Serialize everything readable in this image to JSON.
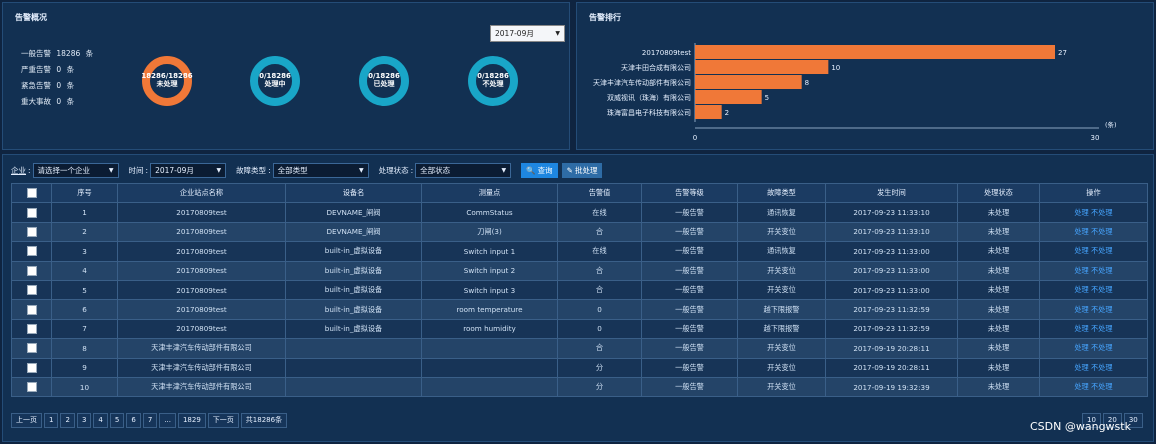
{
  "summary": {
    "title": "告警概况",
    "month": "2017-09月",
    "stats": [
      {
        "label": "一般告警",
        "value": "18286",
        "unit": "条"
      },
      {
        "label": "严重告警",
        "value": "0",
        "unit": "条"
      },
      {
        "label": "紧急告警",
        "value": "0",
        "unit": "条"
      },
      {
        "label": "重大事故",
        "value": "0",
        "unit": "条"
      }
    ],
    "donuts": [
      {
        "ratio": "18286/18286",
        "label": "未处理",
        "fraction": 1.0,
        "color": "#f07838"
      },
      {
        "ratio": "0/18286",
        "label": "处理中",
        "fraction": 1.0,
        "color": "#19a6c8"
      },
      {
        "ratio": "0/18286",
        "label": "已处理",
        "fraction": 1.0,
        "color": "#19a6c8"
      },
      {
        "ratio": "0/18286",
        "label": "不处理",
        "fraction": 1.0,
        "color": "#19a6c8"
      }
    ]
  },
  "ranking": {
    "title": "告警排行",
    "unit": "(条)",
    "chart_data": {
      "type": "bar",
      "orientation": "horizontal",
      "categories": [
        "20170809test",
        "天津丰田合成有限公司",
        "天津丰津汽车传动部件有限公司",
        "双威视讯（珠海）有限公司",
        "珠海富昌电子科技有限公司"
      ],
      "values": [
        27,
        10,
        8,
        5,
        2
      ],
      "xlim": [
        0,
        30
      ],
      "xticks": [
        "0",
        "30"
      ],
      "bar_color": "#f07838"
    }
  },
  "filters": {
    "enterprise_label": "企业",
    "enterprise_value": "请选择一个企业",
    "time_label": "时间",
    "time_value": "2017-09月",
    "fault_label": "故障类型",
    "fault_value": "全部类型",
    "status_label": "处理状态",
    "status_value": "全部状态",
    "query_label": "查询",
    "batch_label": "批处理"
  },
  "table": {
    "headers": [
      "序号",
      "企业站点名称",
      "设备名",
      "测量点",
      "告警值",
      "告警等级",
      "故障类型",
      "发生时间",
      "处理状态",
      "操作"
    ],
    "rows": [
      {
        "no": "1",
        "site": "20170809test",
        "device": "DEVNAME_闸阀",
        "point": "CommStatus",
        "value": "在线",
        "level": "一般告警",
        "fault": "通讯恢复",
        "time": "2017-09-23 11:33:10",
        "status": "未处理",
        "op1": "处理",
        "op2": "不处理"
      },
      {
        "no": "2",
        "site": "20170809test",
        "device": "DEVNAME_闸阀",
        "point": "刀闸(3)",
        "value": "合",
        "level": "一般告警",
        "fault": "开关变位",
        "time": "2017-09-23 11:33:10",
        "status": "未处理",
        "op1": "处理",
        "op2": "不处理"
      },
      {
        "no": "3",
        "site": "20170809test",
        "device": "built-in_虚拟设备",
        "point": "Switch input 1",
        "value": "在线",
        "level": "一般告警",
        "fault": "通讯恢复",
        "time": "2017-09-23 11:33:00",
        "status": "未处理",
        "op1": "处理",
        "op2": "不处理"
      },
      {
        "no": "4",
        "site": "20170809test",
        "device": "built-in_虚拟设备",
        "point": "Switch input 2",
        "value": "合",
        "level": "一般告警",
        "fault": "开关变位",
        "time": "2017-09-23 11:33:00",
        "status": "未处理",
        "op1": "处理",
        "op2": "不处理"
      },
      {
        "no": "5",
        "site": "20170809test",
        "device": "built-in_虚拟设备",
        "point": "Switch input 3",
        "value": "合",
        "level": "一般告警",
        "fault": "开关变位",
        "time": "2017-09-23 11:33:00",
        "status": "未处理",
        "op1": "处理",
        "op2": "不处理"
      },
      {
        "no": "6",
        "site": "20170809test",
        "device": "built-in_虚拟设备",
        "point": "room temperature",
        "value": "0",
        "level": "一般告警",
        "fault": "越下限报警",
        "time": "2017-09-23 11:32:59",
        "status": "未处理",
        "op1": "处理",
        "op2": "不处理"
      },
      {
        "no": "7",
        "site": "20170809test",
        "device": "built-in_虚拟设备",
        "point": "room humidity",
        "value": "0",
        "level": "一般告警",
        "fault": "越下限报警",
        "time": "2017-09-23 11:32:59",
        "status": "未处理",
        "op1": "处理",
        "op2": "不处理"
      },
      {
        "no": "8",
        "site": "天津丰津汽车传动部件有限公司",
        "device": "",
        "point": "",
        "value": "合",
        "level": "一般告警",
        "fault": "开关变位",
        "time": "2017-09-19 20:28:11",
        "status": "未处理",
        "op1": "处理",
        "op2": "不处理"
      },
      {
        "no": "9",
        "site": "天津丰津汽车传动部件有限公司",
        "device": "",
        "point": "",
        "value": "分",
        "level": "一般告警",
        "fault": "开关变位",
        "time": "2017-09-19 20:28:11",
        "status": "未处理",
        "op1": "处理",
        "op2": "不处理"
      },
      {
        "no": "10",
        "site": "天津丰津汽车传动部件有限公司",
        "device": "",
        "point": "",
        "value": "分",
        "level": "一般告警",
        "fault": "开关变位",
        "time": "2017-09-19 19:32:39",
        "status": "未处理",
        "op1": "处理",
        "op2": "不处理"
      }
    ]
  },
  "pager": {
    "prev": "上一页",
    "pages": [
      "1",
      "2",
      "3",
      "4",
      "5",
      "6",
      "7",
      "...",
      "1829"
    ],
    "next": "下一页",
    "total": "共18286条",
    "sizes": [
      "10",
      "20",
      "30"
    ]
  },
  "watermark": "CSDN @wangwstk"
}
